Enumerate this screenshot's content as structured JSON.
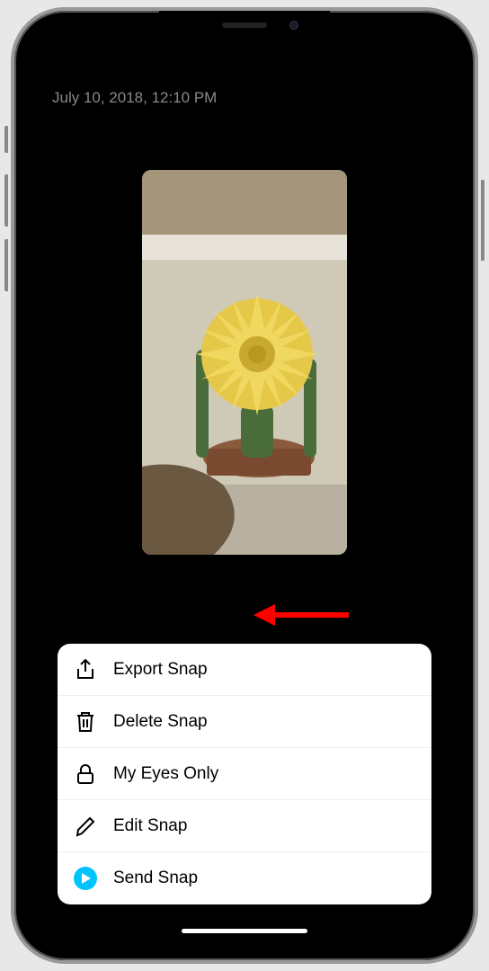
{
  "timestamp": "July 10, 2018, 12:10 PM",
  "menu": {
    "items": [
      {
        "icon": "export-icon",
        "label": "Export Snap"
      },
      {
        "icon": "trash-icon",
        "label": "Delete Snap"
      },
      {
        "icon": "lock-icon",
        "label": "My Eyes Only"
      },
      {
        "icon": "edit-icon",
        "label": "Edit Snap"
      },
      {
        "icon": "send-icon",
        "label": "Send Snap"
      }
    ]
  },
  "colors": {
    "send_accent": "#00c3ff",
    "arrow": "#ff0000"
  }
}
